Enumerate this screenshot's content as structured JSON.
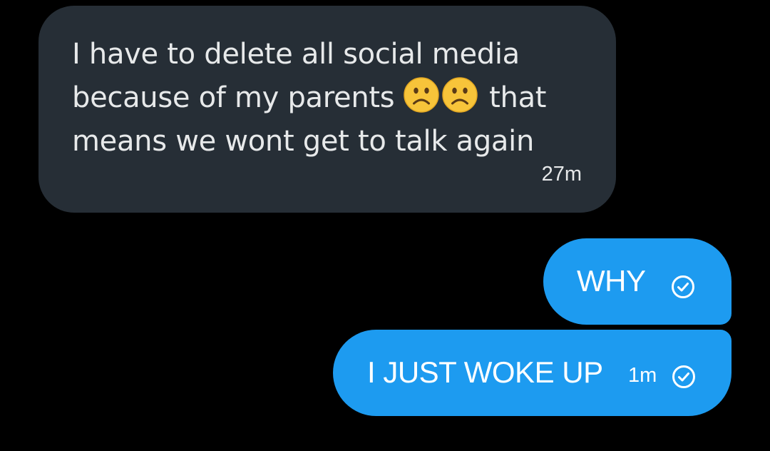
{
  "messages": [
    {
      "direction": "incoming",
      "text_line1": "I have to delete all social media",
      "text_line2_before": "because of my parents",
      "emojis": [
        "slightly-frowning-face",
        "slightly-frowning-face"
      ],
      "text_line2_after": "that",
      "text_line3": "means we wont get to talk again",
      "timestamp": "27m"
    },
    {
      "direction": "outgoing",
      "text": "WHY",
      "status_icon": "sent-check-icon"
    },
    {
      "direction": "outgoing",
      "text": "I JUST WOKE UP",
      "timestamp": "1m",
      "status_icon": "sent-check-icon"
    }
  ],
  "colors": {
    "background": "#000000",
    "incoming_bubble": "#262e36",
    "outgoing_bubble": "#1d9bf0",
    "text": "#e7e9ea",
    "emoji_face": "#f7c43a"
  }
}
